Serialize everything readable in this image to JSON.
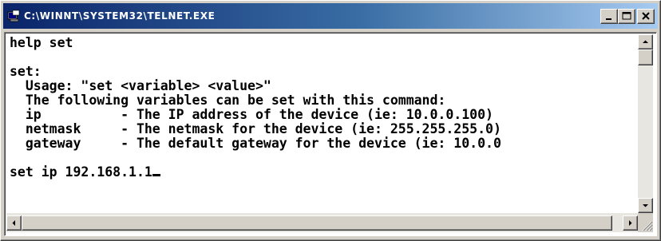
{
  "window": {
    "title": "C:\\WINNT\\SYSTEM32\\TELNET.EXE",
    "icons": {
      "app": "console-app-icon",
      "minimize": "minimize-icon",
      "maximize": "maximize-icon",
      "close": "close-icon"
    }
  },
  "console": {
    "lines": [
      "help set",
      "",
      "set:",
      "  Usage: \"set <variable> <value>\"",
      "  The following variables can be set with this command:",
      "  ip          - The IP address of the device (ie: 10.0.0.100)",
      "  netmask     - The netmask for the device (ie: 255.255.255.0)",
      "  gateway     - The default gateway for the device (ie: 10.0.0",
      "",
      "set ip 192.168.1.1"
    ]
  },
  "scrollbars": {
    "vertical": {
      "up_icon": "arrow-up-icon",
      "down_icon": "arrow-down-icon"
    },
    "horizontal": {
      "left_icon": "arrow-left-icon",
      "right_icon": "arrow-right-icon"
    }
  }
}
